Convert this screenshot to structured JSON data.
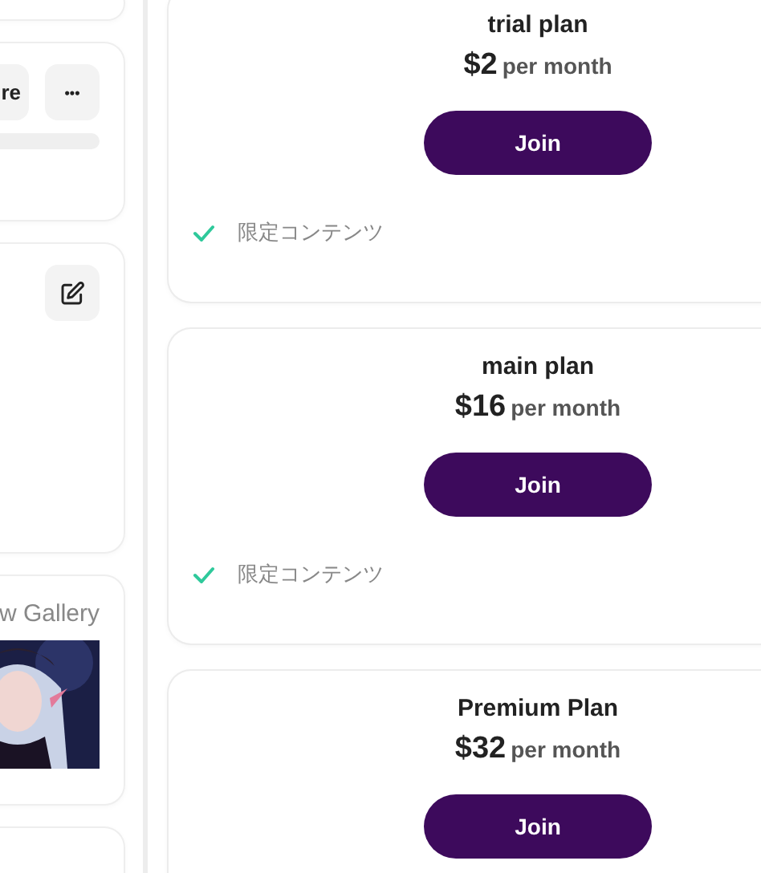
{
  "sidebar": {
    "action_buttons": [
      "re",
      "•••"
    ],
    "gallery_heading": "w Gallery",
    "gallery_picture": {
      "kind": "picture"
    }
  },
  "plans": [
    {
      "name": "trial plan",
      "price": "$2",
      "period": "per month",
      "button": "Join",
      "features": [
        "限定コンテンツ"
      ]
    },
    {
      "name": "main plan",
      "price": "$16",
      "period": "per month",
      "button": "Join",
      "features": [
        "限定コンテンツ"
      ]
    },
    {
      "name": "Premium Plan",
      "price": "$32",
      "period": "per month",
      "button": "Join"
    }
  ]
}
